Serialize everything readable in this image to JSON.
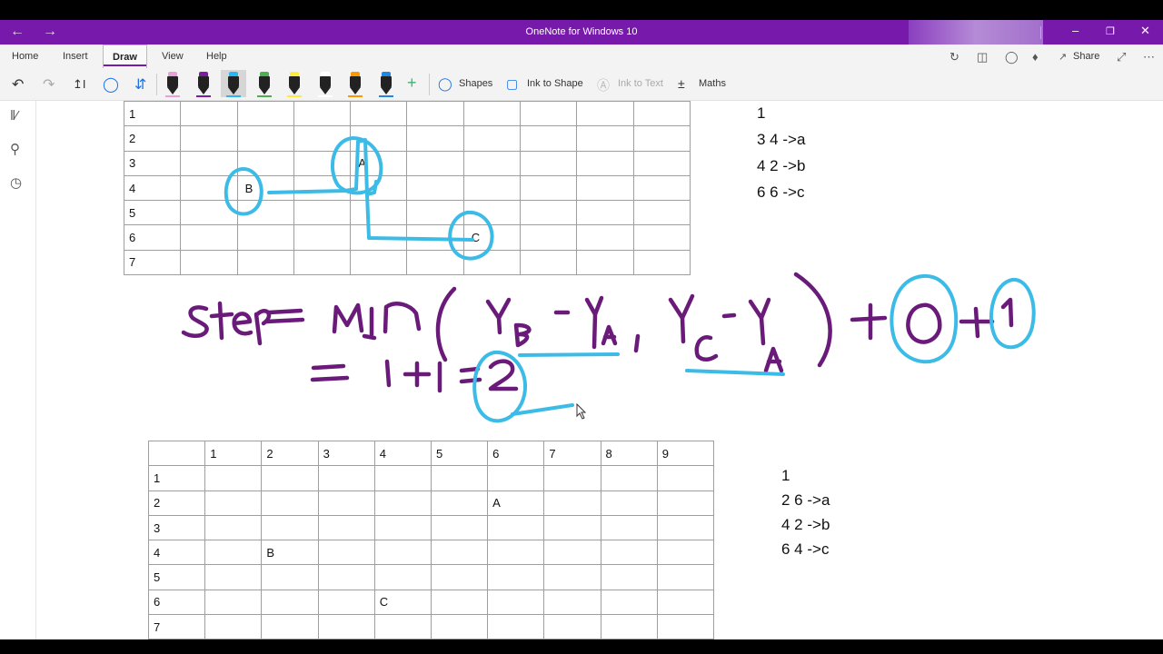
{
  "window": {
    "title": "OneNote for Windows 10",
    "back_icon": "back-arrow-icon",
    "forward_icon": "forward-arrow-icon"
  },
  "menu": {
    "tabs": [
      "Home",
      "Insert",
      "Draw",
      "View",
      "Help"
    ],
    "active_tab": "Draw",
    "share_label": "Share"
  },
  "toolbar": {
    "shapes_label": "Shapes",
    "ink_to_shape_label": "Ink to Shape",
    "ink_to_text_label": "Ink to Text",
    "maths_label": "Maths",
    "pens": [
      {
        "name": "pen-pink",
        "color": "#e8a0d8"
      },
      {
        "name": "pen-purple",
        "color": "#7b1fa2"
      },
      {
        "name": "pen-lightblue",
        "color": "#29b6f6"
      },
      {
        "name": "pen-green",
        "color": "#4caf50"
      },
      {
        "name": "highlighter-yellow",
        "color": "#ffeb3b"
      },
      {
        "name": "pen-galaxy",
        "color": "#ffffff"
      },
      {
        "name": "pen-rainbow",
        "color": "#ff9800"
      },
      {
        "name": "pen-ocean",
        "color": "#1e88e5"
      }
    ]
  },
  "grid1": {
    "rows": [
      {
        "label": "1",
        "cells": [
          "",
          "",
          "",
          "",
          "",
          "",
          "",
          "",
          "",
          ""
        ]
      },
      {
        "label": "2",
        "cells": [
          "",
          "",
          "",
          "",
          "",
          "",
          "",
          "",
          "",
          ""
        ]
      },
      {
        "label": "3",
        "cells": [
          "",
          "",
          "",
          "A",
          "",
          "",
          "",
          "",
          "",
          ""
        ]
      },
      {
        "label": "4",
        "cells": [
          "",
          "B",
          "",
          "",
          "",
          "",
          "",
          "",
          "",
          ""
        ]
      },
      {
        "label": "5",
        "cells": [
          "",
          "",
          "",
          "",
          "",
          "",
          "",
          "",
          "",
          ""
        ]
      },
      {
        "label": "6",
        "cells": [
          "",
          "",
          "",
          "",
          "",
          "C",
          "",
          "",
          "",
          ""
        ]
      },
      {
        "label": "7",
        "cells": [
          "",
          "",
          "",
          "",
          "",
          "",
          "",
          "",
          "",
          ""
        ]
      }
    ]
  },
  "notes1": [
    "1",
    "3 4 ->a",
    "4 2 ->b",
    "6 6 ->c"
  ],
  "grid2": {
    "header": [
      "",
      "1",
      "2",
      "3",
      "4",
      "5",
      "6",
      "7",
      "8",
      "9"
    ],
    "rows": [
      {
        "label": "1",
        "cells": [
          "",
          "",
          "",
          "",
          "",
          "",
          "",
          "",
          ""
        ]
      },
      {
        "label": "2",
        "cells": [
          "",
          "",
          "",
          "",
          "",
          "A",
          "",
          "",
          ""
        ]
      },
      {
        "label": "3",
        "cells": [
          "",
          "",
          "",
          "",
          "",
          "",
          "",
          "",
          ""
        ]
      },
      {
        "label": "4",
        "cells": [
          "",
          "B",
          "",
          "",
          "",
          "",
          "",
          "",
          ""
        ]
      },
      {
        "label": "5",
        "cells": [
          "",
          "",
          "",
          "",
          "",
          "",
          "",
          "",
          ""
        ]
      },
      {
        "label": "6",
        "cells": [
          "",
          "",
          "",
          "C",
          "",
          "",
          "",
          "",
          ""
        ]
      },
      {
        "label": "7",
        "cells": [
          "",
          "",
          "",
          "",
          "",
          "",
          "",
          "",
          ""
        ]
      }
    ]
  },
  "notes2": [
    "1",
    "2 6 ->a",
    "4 2 ->b",
    "6 4 ->c"
  ],
  "ink_colors": {
    "purple": "#6a1b7a",
    "blue": "#3cbbe6"
  }
}
